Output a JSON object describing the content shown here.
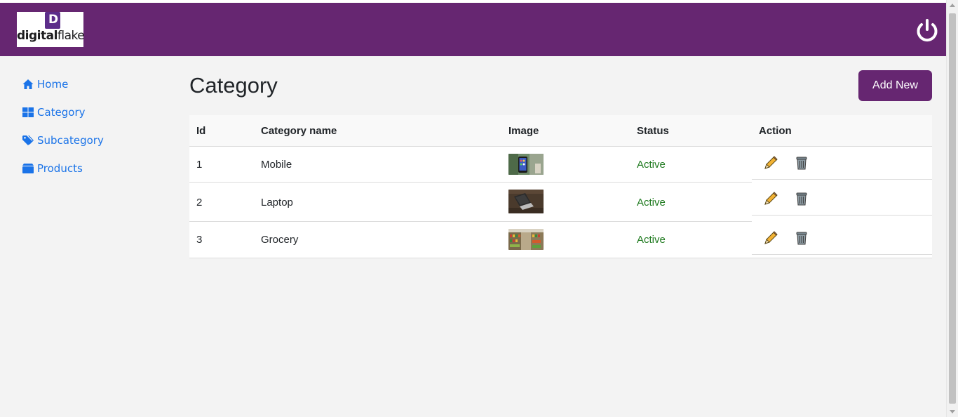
{
  "brand": {
    "logo_letter": "D",
    "logo_text_bold": "digital",
    "logo_text_light": "flake",
    "color": "#662671"
  },
  "header": {
    "power_icon": "power-icon"
  },
  "sidebar": {
    "items": [
      {
        "label": "Home",
        "icon": "home-icon"
      },
      {
        "label": "Category",
        "icon": "grid-icon"
      },
      {
        "label": "Subcategory",
        "icon": "tags-icon"
      },
      {
        "label": "Products",
        "icon": "box-icon"
      }
    ]
  },
  "main": {
    "title": "Category",
    "add_button_label": "Add New",
    "table": {
      "headers": [
        "Id",
        "Category name",
        "Image",
        "Status",
        "Action"
      ],
      "rows": [
        {
          "id": "1",
          "name": "Mobile",
          "image": "mobile-thumbnail",
          "status": "Active"
        },
        {
          "id": "2",
          "name": "Laptop",
          "image": "laptop-thumbnail",
          "status": "Active"
        },
        {
          "id": "3",
          "name": "Grocery",
          "image": "grocery-thumbnail",
          "status": "Active"
        }
      ]
    },
    "status_color": "#1f7a1f"
  }
}
